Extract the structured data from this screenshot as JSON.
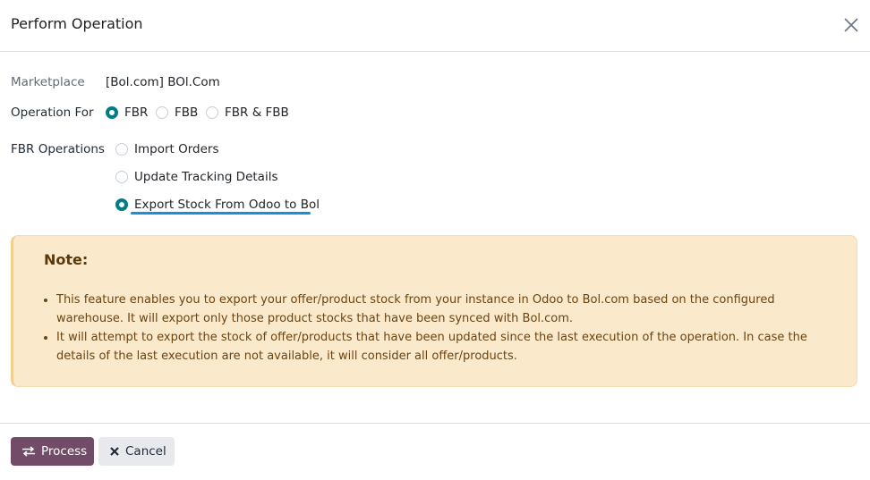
{
  "dialog": {
    "title": "Perform Operation",
    "close_icon": "close-icon"
  },
  "form": {
    "marketplace": {
      "label": "Marketplace",
      "value": "[Bol.com] BOl.Com"
    },
    "operation_for": {
      "label": "Operation For",
      "options": [
        "FBR",
        "FBB",
        "FBR & FBB"
      ],
      "selected": "FBR"
    },
    "fbr_operations": {
      "label": "FBR Operations",
      "options": [
        "Import Orders",
        "Update Tracking Details",
        "Export Stock From Odoo to Bol"
      ],
      "selected": "Export Stock From Odoo to Bol"
    }
  },
  "note": {
    "title": "Note:",
    "items": [
      "This feature enables you to export your offer/product stock from your instance in Odoo to Bol.com based on the configured warehouse. It will export only those product stocks that have been synced with Bol.com.",
      "It will attempt to export the stock of offer/products that have been updated since the last execution of the operation. In case the details of the last execution are not available, it will consider all offer/products."
    ]
  },
  "footer": {
    "process_label": "Process",
    "cancel_label": "Cancel"
  },
  "colors": {
    "primary": "#714b67",
    "radio_checked": "#017e84",
    "note_bg": "#fbe9cc",
    "highlight_underline": "#1590e0"
  }
}
